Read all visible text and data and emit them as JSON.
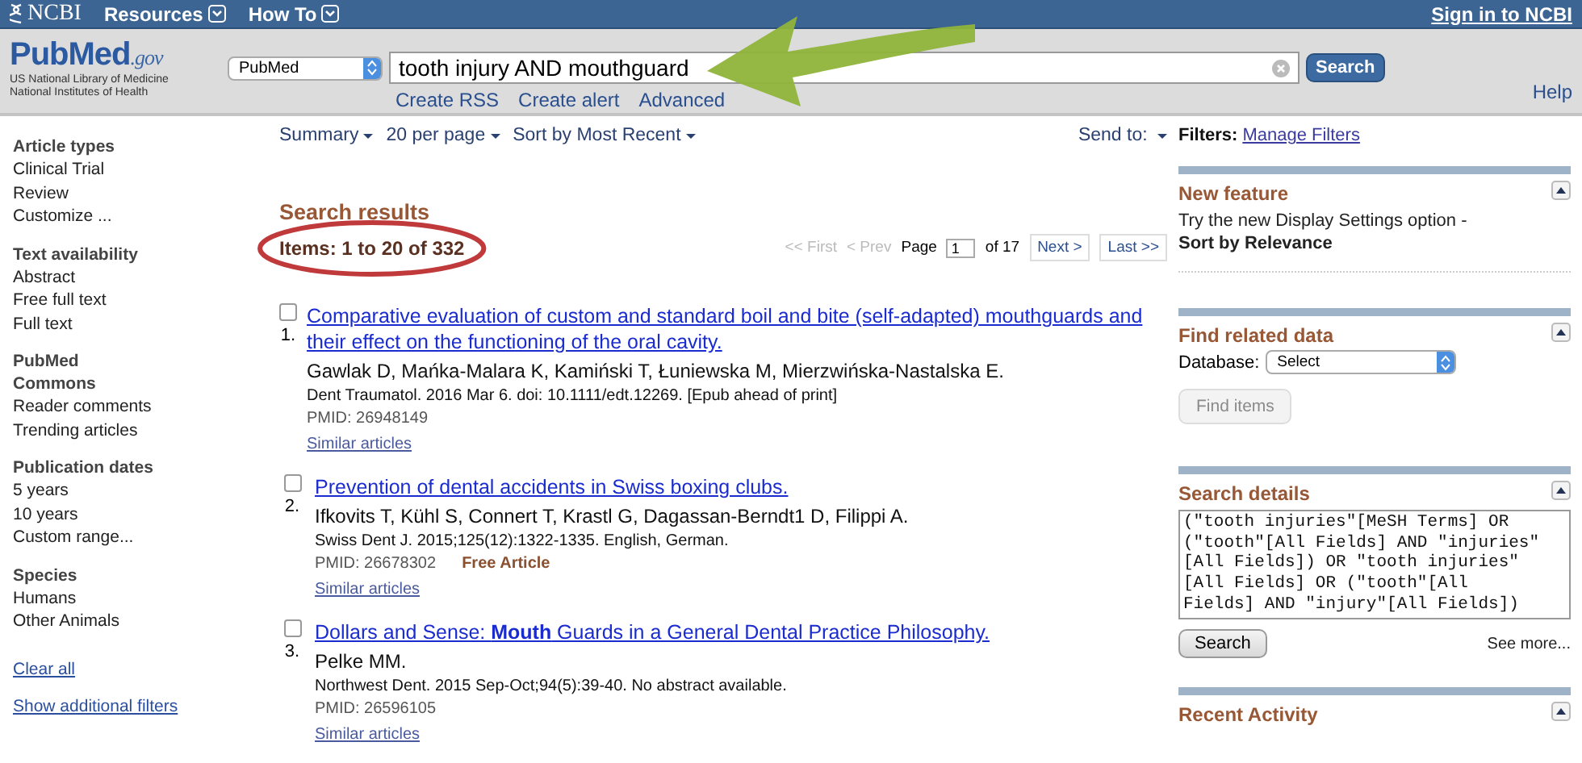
{
  "topbar": {
    "logo": "NCBI",
    "menus": [
      "Resources",
      "How To"
    ],
    "sign_in": "Sign in to NCBI"
  },
  "header": {
    "logo": {
      "brand": "PubMed",
      "suffix": ".gov",
      "lines": [
        "US National Library of Medicine",
        "National Institutes of Health"
      ]
    },
    "database": "PubMed",
    "query": "tooth injury AND mouthguard",
    "search_button": "Search",
    "links": [
      "Create RSS",
      "Create alert",
      "Advanced"
    ],
    "help": "Help"
  },
  "sidebar": {
    "groups": [
      {
        "title": "Article types",
        "items": [
          "Clinical Trial",
          "Review",
          "Customize ..."
        ]
      },
      {
        "title": "Text availability",
        "items": [
          "Abstract",
          "Free full text",
          "Full text"
        ]
      },
      {
        "title": "PubMed Commons",
        "items": [
          "Reader comments",
          "Trending articles"
        ]
      },
      {
        "title": "Publication dates",
        "items": [
          "5 years",
          "10 years",
          "Custom range..."
        ]
      },
      {
        "title": "Species",
        "items": [
          "Humans",
          "Other Animals"
        ]
      }
    ],
    "links": [
      "Clear all",
      "Show additional filters"
    ]
  },
  "toolbar": {
    "menus": [
      "Summary",
      "20 per page",
      "Sort by Most Recent"
    ],
    "send_to": "Send to:"
  },
  "results": {
    "heading": "Search results",
    "count": "Items: 1 to 20 of 332",
    "pager": {
      "buttons": [
        {
          "label": "<< First",
          "disabled": true
        },
        {
          "label": "< Prev",
          "disabled": true
        }
      ],
      "page_label": "Page",
      "page": "1",
      "of": "of 17",
      "nav": [
        {
          "label": "Next >",
          "disabled": false
        },
        {
          "label": "Last >>",
          "disabled": false
        }
      ]
    },
    "items": [
      {
        "number": "1.",
        "checked": false,
        "title": "Comparative evaluation of custom and standard boil and bite (self-adapted) mouthguards and their effect on the functioning of the oral cavity.",
        "authors": "Gawlak D, Mańka-Malara K, Kamiński T, Łuniewska M, Mierzwińska-Nastalska E.",
        "citation": "Dent Traumatol. 2016 Mar 6. doi: 10.1111/edt.12269. [Epub ahead of print]",
        "pmid": "PMID: 26948149",
        "similar": "Similar articles"
      },
      {
        "number": "2.",
        "checked": false,
        "title": "Prevention of dental accidents in Swiss boxing clubs.",
        "authors": "Ifkovits T, Kühl S, Connert T, Krastl G, Dagassan-Berndt1 D, Filippi A.",
        "citation": "Swiss Dent J. 2015;125(12):1322-1335. English, German.",
        "pmid": "PMID: 26678302",
        "free": "Free Article",
        "similar": "Similar articles"
      },
      {
        "number": "3.",
        "checked": false,
        "title": "Dollars and Sense: **Mouth** Guards in a General Dental Practice Philosophy.",
        "authors": "Pelke MM.",
        "citation": "Northwest Dent. 2015 Sep-Oct;94(5):39-40. No abstract available.",
        "pmid": "PMID: 26596105",
        "similar": "Similar articles"
      }
    ]
  },
  "right": {
    "filters_label": "Filters:",
    "manage_filters": "Manage Filters",
    "panels": [
      {
        "kind": "text",
        "title": "New feature",
        "text": "Try the new Display Settings option -",
        "bold": "Sort by Relevance"
      },
      {
        "kind": "database",
        "title": "Find related data",
        "label": "Database:",
        "select": "Select",
        "button": "Find items",
        "button_disabled": true
      },
      {
        "kind": "details",
        "title": "Search details",
        "query": "(\"tooth injuries\"[MeSH Terms] OR\n(\"tooth\"[All Fields] AND \"injuries\"\n[All Fields]) OR \"tooth injuries\"\n[All Fields] OR (\"tooth\"[All\nFields] AND \"injury\"[All Fields])",
        "button": "Search",
        "more": "See more..."
      },
      {
        "kind": "empty",
        "title": "Recent Activity"
      }
    ]
  }
}
